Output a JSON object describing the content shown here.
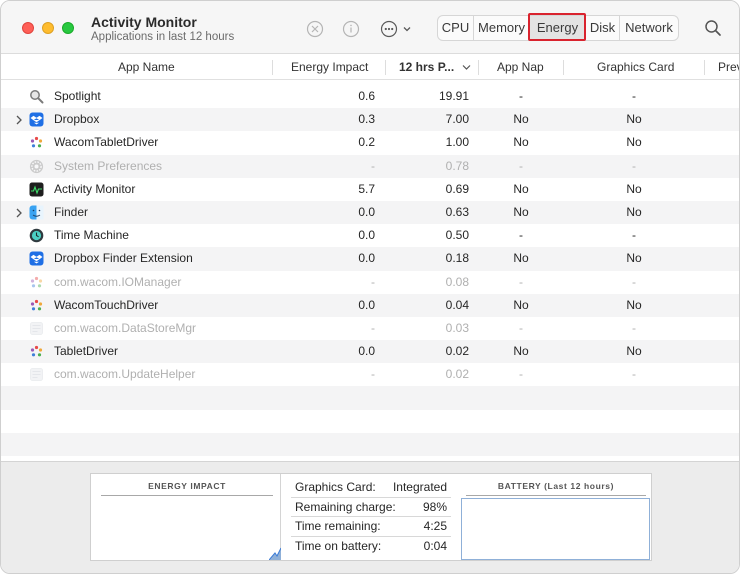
{
  "window": {
    "title": "Activity Monitor",
    "subtitle": "Applications in last 12 hours"
  },
  "toolbar": {
    "tabs": [
      {
        "label": "CPU"
      },
      {
        "label": "Memory"
      },
      {
        "label": "Energy",
        "selected": true
      },
      {
        "label": "Disk"
      },
      {
        "label": "Network"
      }
    ],
    "icons": [
      "stop-process-icon",
      "info-icon",
      "more-actions-icon",
      "search-icon"
    ],
    "highlight_color": "#d9232e"
  },
  "columns": {
    "app_name": "App Name",
    "energy_impact": "Energy Impact",
    "hrs": "12 hrs P...",
    "app_nap": "App Nap",
    "graphics_card": "Graphics Card",
    "prev": "Prev"
  },
  "rows": [
    {
      "name": "Spotlight",
      "impact": "0.6",
      "hrs": "19.91",
      "nap": "-",
      "gfx": "-",
      "icon": "magnifier-icon",
      "dim": false,
      "expandable": false
    },
    {
      "name": "Dropbox",
      "impact": "0.3",
      "hrs": "7.00",
      "nap": "No",
      "gfx": "No",
      "icon": "dropbox-icon",
      "dim": false,
      "expandable": true
    },
    {
      "name": "WacomTabletDriver",
      "impact": "0.2",
      "hrs": "1.00",
      "nap": "No",
      "gfx": "No",
      "icon": "wacom-icon",
      "dim": false,
      "expandable": false
    },
    {
      "name": "System Preferences",
      "impact": "-",
      "hrs": "0.78",
      "nap": "-",
      "gfx": "-",
      "icon": "gear-icon",
      "dim": true,
      "expandable": false
    },
    {
      "name": "Activity Monitor",
      "impact": "5.7",
      "hrs": "0.69",
      "nap": "No",
      "gfx": "No",
      "icon": "activity-monitor-icon",
      "dim": false,
      "expandable": false
    },
    {
      "name": "Finder",
      "impact": "0.0",
      "hrs": "0.63",
      "nap": "No",
      "gfx": "No",
      "icon": "finder-icon",
      "dim": false,
      "expandable": true
    },
    {
      "name": "Time Machine",
      "impact": "0.0",
      "hrs": "0.50",
      "nap": "-",
      "gfx": "-",
      "icon": "time-machine-icon",
      "dim": false,
      "expandable": false
    },
    {
      "name": "Dropbox Finder Extension",
      "impact": "0.0",
      "hrs": "0.18",
      "nap": "No",
      "gfx": "No",
      "icon": "dropbox-icon",
      "dim": false,
      "expandable": false
    },
    {
      "name": "com.wacom.IOManager",
      "impact": "-",
      "hrs": "0.08",
      "nap": "-",
      "gfx": "-",
      "icon": "wacom-icon",
      "dim": true,
      "expandable": false
    },
    {
      "name": "WacomTouchDriver",
      "impact": "0.0",
      "hrs": "0.04",
      "nap": "No",
      "gfx": "No",
      "icon": "wacom-icon",
      "dim": false,
      "expandable": false
    },
    {
      "name": "com.wacom.DataStoreMgr",
      "impact": "-",
      "hrs": "0.03",
      "nap": "-",
      "gfx": "-",
      "icon": "generic-app-icon",
      "dim": true,
      "expandable": false
    },
    {
      "name": "TabletDriver",
      "impact": "0.0",
      "hrs": "0.02",
      "nap": "No",
      "gfx": "No",
      "icon": "wacom-icon",
      "dim": false,
      "expandable": false
    },
    {
      "name": "com.wacom.UpdateHelper",
      "impact": "-",
      "hrs": "0.02",
      "nap": "-",
      "gfx": "-",
      "icon": "generic-app-icon",
      "dim": true,
      "expandable": false
    }
  ],
  "bottom": {
    "energy_impact_title": "ENERGY IMPACT",
    "battery_title": "BATTERY (Last 12 hours)",
    "stats": [
      {
        "label": "Graphics Card:",
        "value": "Integrated"
      },
      {
        "label": "Remaining charge:",
        "value": "98%"
      },
      {
        "label": "Time remaining:",
        "value": "4:25"
      },
      {
        "label": "Time on battery:",
        "value": "0:04"
      }
    ]
  }
}
